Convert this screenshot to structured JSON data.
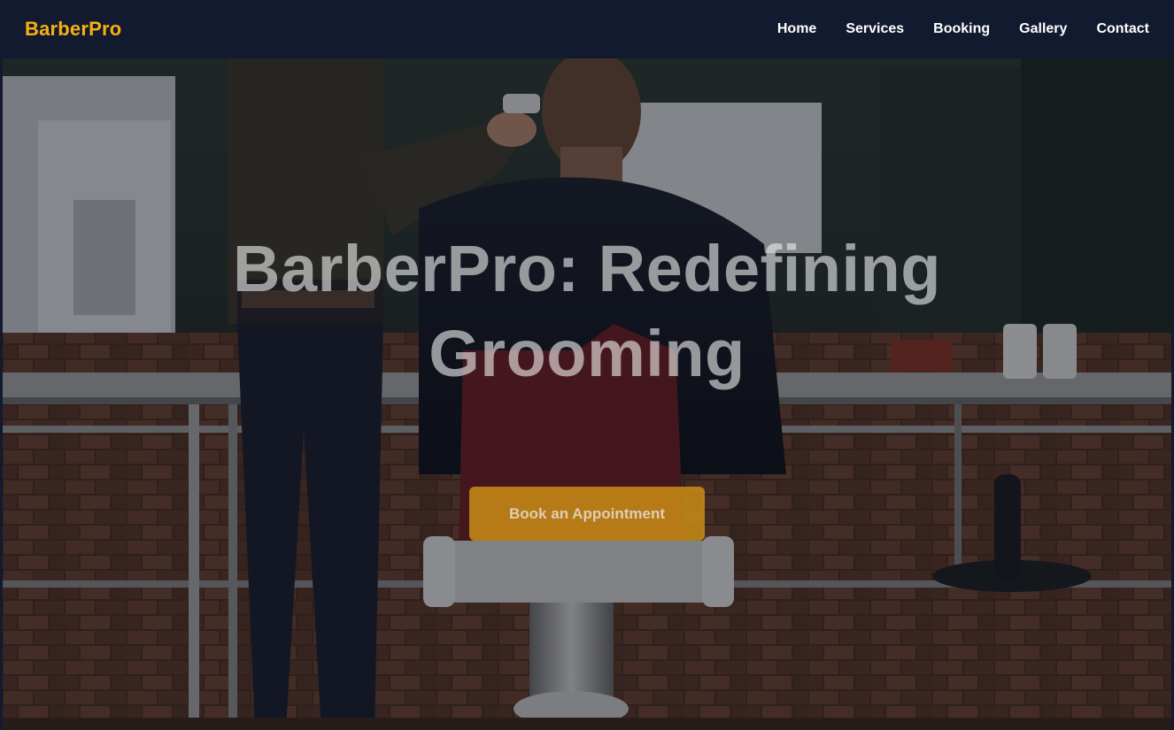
{
  "brand": {
    "name": "BarberPro"
  },
  "nav": {
    "items": [
      {
        "label": "Home"
      },
      {
        "label": "Services"
      },
      {
        "label": "Booking"
      },
      {
        "label": "Gallery"
      },
      {
        "label": "Contact"
      }
    ]
  },
  "hero": {
    "title_line1": "BarberPro: Redefining",
    "title_line2": "Grooming",
    "cta_label": "Book an Appointment",
    "image_subject": "barber-shop-photo"
  },
  "colors": {
    "navbar_bg": "#111a2e",
    "brand_accent": "#f6b013",
    "cta_bg": "#d69616"
  }
}
